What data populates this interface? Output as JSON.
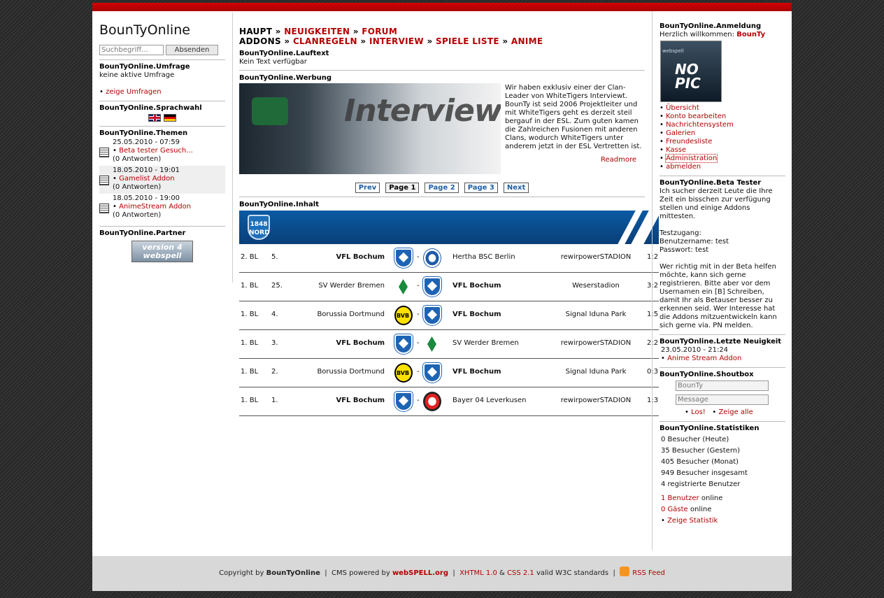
{
  "site": {
    "name": "BounTyOnline"
  },
  "left": {
    "search": {
      "placeholder": "Suchbegriff...",
      "button": "Absenden"
    },
    "poll": {
      "title": "BounTyOnline.Umfrage",
      "text": "keine aktive Umfrage",
      "link": "zeige Umfragen"
    },
    "lang": {
      "title": "BounTyOnline.Sprachwahl"
    },
    "topics": {
      "title": "BounTyOnline.Themen",
      "items": [
        {
          "date": "25.05.2010 - 07:59",
          "title": "Beta tester Gesuch...",
          "replies": "(0 Antworten)"
        },
        {
          "date": "18.05.2010 - 19:01",
          "title": "Gamelist Addon",
          "replies": "(0 Antworten)"
        },
        {
          "date": "18.05.2010 - 19:00",
          "title": "AnimeStream Addon",
          "replies": "(0 Antworten)"
        }
      ]
    },
    "partner": {
      "title": "BounTyOnline.Partner",
      "badge_top": "version 4",
      "badge_bottom": "webspell"
    }
  },
  "nav": {
    "row1": [
      "HAUPT",
      "NEUIGKEITEN",
      "FORUM"
    ],
    "row2": [
      "ADDONS",
      "CLANREGELN",
      "INTERVIEW",
      "SPIELE LISTE",
      "ANIME"
    ],
    "sep": "»"
  },
  "ticker": {
    "title": "BounTyOnline.Lauftext",
    "text": "Kein Text verfügbar"
  },
  "ad": {
    "title": "BounTyOnline.Werbung",
    "image_text": "Interview",
    "text": "Wir haben exklusiv einer der Clan-Leader von WhiteTigers Interviewt. BounTy ist seid 2006 Projektleiter und mit WhiteTigers geht es derzeit steil bergauf in der ESL. Zum guten kamen die Zahlreichen Fusionen mit anderen Clans, wodurch WhiteTigers unter anderem jetzt in der ESL Vertretten ist.",
    "readmore": "Readmore"
  },
  "pager": {
    "prev": "Prev",
    "p1": "Page 1",
    "p2": "Page 2",
    "p3": "Page 3",
    "next": "Next"
  },
  "content": {
    "title": "BounTyOnline.Inhalt",
    "banner_text": "1848 NORD",
    "matches": [
      {
        "league": "2. BL",
        "round": "5.",
        "home": "VFL Bochum",
        "away": "Hertha BSC Berlin",
        "stadium": "rewirpowerSTADION",
        "score": "1:2",
        "home_bold": true,
        "home_crest": "vfl-crest-icon",
        "away_crest": "hertha-crest-icon"
      },
      {
        "league": "1. BL",
        "round": "25.",
        "home": "SV Werder Bremen",
        "away": "VFL Bochum",
        "stadium": "Weserstadion",
        "score": "3:2",
        "home_bold": false,
        "home_crest": "werder-crest-icon",
        "away_crest": "vfl-crest-icon"
      },
      {
        "league": "1. BL",
        "round": "4.",
        "home": "Borussia Dortmund",
        "away": "VFL Bochum",
        "stadium": "Signal Iduna Park",
        "score": "1:5",
        "home_bold": false,
        "home_crest": "bvb-crest-icon",
        "away_crest": "vfl-crest-icon"
      },
      {
        "league": "1. BL",
        "round": "3.",
        "home": "VFL Bochum",
        "away": "SV Werder Bremen",
        "stadium": "rewirpowerSTADION",
        "score": "2:2",
        "home_bold": true,
        "home_crest": "vfl-crest-icon",
        "away_crest": "werder-crest-icon"
      },
      {
        "league": "1. BL",
        "round": "2.",
        "home": "Borussia Dortmund",
        "away": "VFL Bochum",
        "stadium": "Signal Iduna Park",
        "score": "0:3",
        "home_bold": false,
        "home_crest": "bvb-crest-icon",
        "away_crest": "vfl-crest-icon"
      },
      {
        "league": "1. BL",
        "round": "1.",
        "home": "VFL Bochum",
        "away": "Bayer 04 Leverkusen",
        "stadium": "rewirpowerSTADION",
        "score": "1:3",
        "home_bold": true,
        "home_crest": "vfl-crest-icon",
        "away_crest": "bayer-crest-icon"
      }
    ]
  },
  "right": {
    "login": {
      "title": "BounTyOnline.Anmeldung",
      "welcome": "Herzlich willkommen:",
      "user": "BounTy",
      "avatar_text": "NO PIC",
      "avatar_side": "webspell",
      "menu": [
        "Übersicht",
        "Konto bearbeiten",
        "Nachrichtensystem",
        "Galerien",
        "Freundesliste",
        "Kasse",
        "Administration",
        "abmelden"
      ]
    },
    "beta": {
      "title": "BounTyOnline.Beta Tester",
      "p1": "Ich sucher derzeit Leute die Ihre Zeit ein bisschen zur verfügung stellen und einige Addons mittesten.",
      "access": "Testzugang:",
      "user": "Benutzername: test",
      "pass": "Passwort: test",
      "p2": "Wer richtig mit in der Beta helfen möchte, kann sich gerne registrieren. Bitte aber vor dem Usernamen ein [B] Schreiben, damit Ihr als Betauser besser zu erkennen seid. Wer Interesse hat die Addons mitzuentwickeln kann sich gerne via. PN melden."
    },
    "news": {
      "title": "BounTyOnline.Letzte Neuigkeit",
      "date": "23.05.2010 - 21:24",
      "item": "Anime Stream Addon"
    },
    "shoutbox": {
      "title": "BounTyOnline.Shoutbox",
      "name_value": "BounTy",
      "msg_placeholder": "Message",
      "send": "Los!",
      "show_all": "Zeige alle"
    },
    "stats": {
      "title": "BounTyOnline.Statistiken",
      "lines": [
        "0 Besucher (Heute)",
        "35 Besucher (Gestern)",
        "405 Besucher (Monat)",
        "949 Besucher insgesamt",
        "4 registrierte Benutzer"
      ],
      "users_online": "1 Benutzer",
      "guests_online": "0 Gäste",
      "online": "online",
      "link": "Zeige Statistik"
    }
  },
  "footer": {
    "copyright": "Copyright by",
    "owner": "BounTyOnline",
    "cms": "CMS powered by",
    "cms_link": "webSPELL.org",
    "xhtml": "XHTML 1.0",
    "amp": "&",
    "css": "CSS 2.1",
    "valid": "valid W3C standards",
    "rss": "RSS Feed",
    "pipe": "|"
  },
  "colors": {
    "accent": "#b30000",
    "topbar": "#c00000",
    "banner": "#0a4f92",
    "pager_link": "#1d5fa6"
  }
}
